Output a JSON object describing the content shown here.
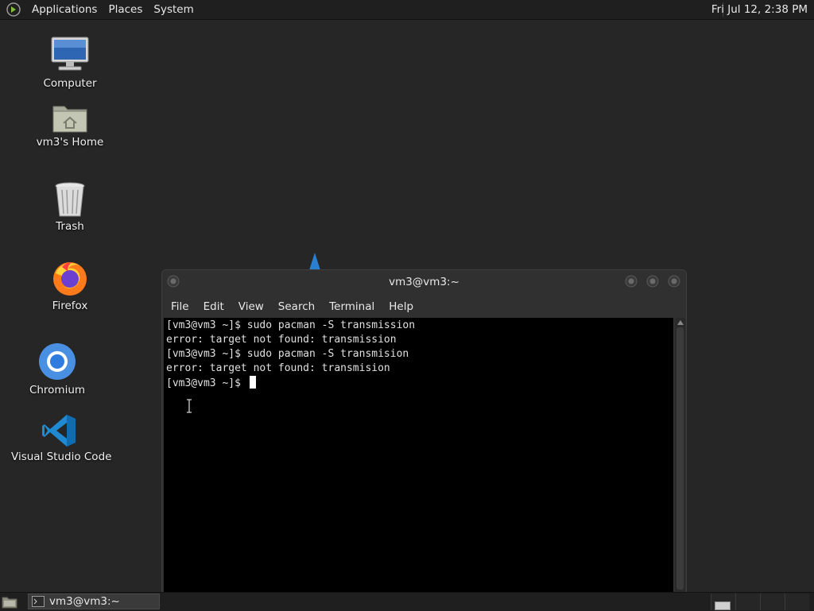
{
  "top_panel": {
    "menus": [
      "Applications",
      "Places",
      "System"
    ],
    "clock": "Fri Jul 12,  2:38 PM"
  },
  "desktop_icons": [
    {
      "label": "Computer",
      "icon": "computer-icon"
    },
    {
      "label": "vm3's Home",
      "icon": "home-folder-icon"
    },
    {
      "label": "Trash",
      "icon": "trash-icon"
    },
    {
      "label": "Firefox",
      "icon": "firefox-icon"
    },
    {
      "label": "Chromium",
      "icon": "chromium-icon"
    },
    {
      "label": "Visual Studio Code",
      "icon": "vscode-icon"
    }
  ],
  "terminal": {
    "title": "vm3@vm3:~",
    "menus": [
      "File",
      "Edit",
      "View",
      "Search",
      "Terminal",
      "Help"
    ],
    "lines": [
      "[vm3@vm3 ~]$ sudo pacman -S transmission",
      "error: target not found: transmission",
      "[vm3@vm3 ~]$ sudo pacman -S transmision",
      "error: target not found: transmision"
    ],
    "prompt": "[vm3@vm3 ~]$ "
  },
  "taskbar": {
    "task_label": "vm3@vm3:~"
  },
  "colors": {
    "desktop": "#262626",
    "panel": "#1f1f1f",
    "terminal_bg": "#000000",
    "terminal_fg": "#e0e0e0"
  }
}
